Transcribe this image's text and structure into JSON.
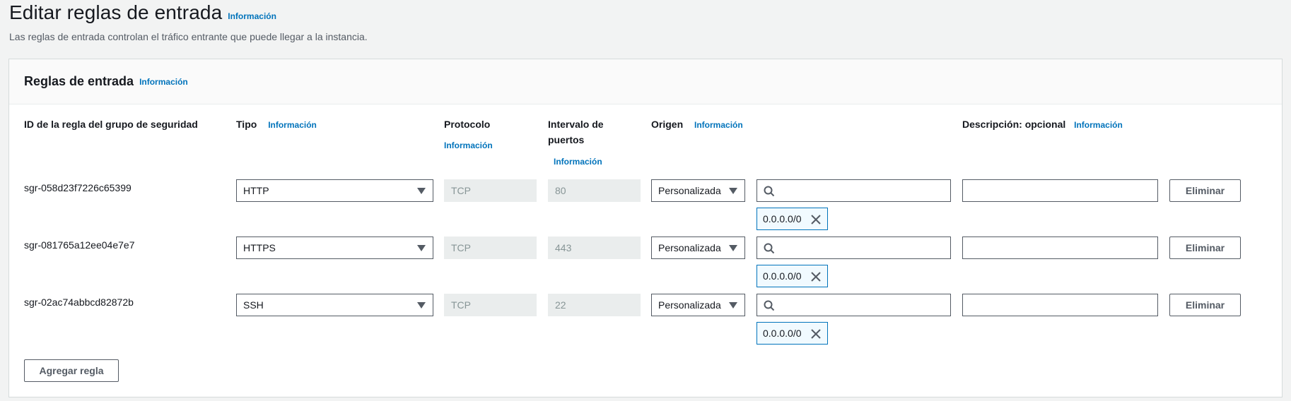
{
  "header": {
    "title": "Editar reglas de entrada",
    "info": "Información",
    "subtitle": "Las reglas de entrada controlan el tráfico entrante que puede llegar a la instancia."
  },
  "panel": {
    "title": "Reglas de entrada",
    "info": "Información",
    "columns": {
      "id": "ID de la regla del grupo de seguridad",
      "type": "Tipo",
      "type_info": "Información",
      "protocol": "Protocolo",
      "protocol_info": "Información",
      "port_line1": "Intervalo de",
      "port_line2": "puertos",
      "port_info": "Información",
      "source": "Origen",
      "source_info": "Información",
      "description": "Descripción: opcional",
      "description_info": "Información"
    },
    "rules": [
      {
        "id": "sgr-058d23f7226c65399",
        "type": "HTTP",
        "protocol": "TCP",
        "port": "80",
        "source": "Personalizada",
        "cidr": "0.0.0.0/0",
        "description": "",
        "delete": "Eliminar"
      },
      {
        "id": "sgr-081765a12ee04e7e7",
        "type": "HTTPS",
        "protocol": "TCP",
        "port": "443",
        "source": "Personalizada",
        "cidr": "0.0.0.0/0",
        "description": "",
        "delete": "Eliminar"
      },
      {
        "id": "sgr-02ac74abbcd82872b",
        "type": "SSH",
        "protocol": "TCP",
        "port": "22",
        "source": "Personalizada",
        "cidr": "0.0.0.0/0",
        "description": "",
        "delete": "Eliminar"
      }
    ],
    "add_rule": "Agregar regla"
  },
  "colors": {
    "link": "#0073bb",
    "border": "#545b64",
    "token_border": "#0073bb",
    "token_bg": "#f1faff",
    "disabled_bg": "#eaeded"
  }
}
